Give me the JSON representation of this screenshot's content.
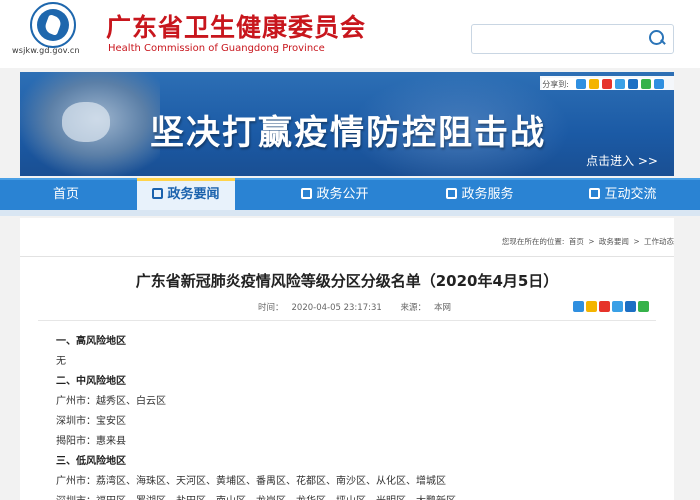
{
  "header": {
    "domain": "wsjkw.gd.gov.cn",
    "title": "广东省卫生健康委员会",
    "subtitle": "Health Commission of Guangdong Province",
    "search_placeholder": ""
  },
  "share": {
    "label": "分享到:"
  },
  "banner": {
    "slogan": "坚决打赢疫情防控阻击战",
    "enter": "点击进入 >>"
  },
  "nav": {
    "items": [
      {
        "label": "首页"
      },
      {
        "label": "政务要闻"
      },
      {
        "label": "政务公开"
      },
      {
        "label": "政务服务"
      },
      {
        "label": "互动交流"
      }
    ]
  },
  "breadcrumb": {
    "prefix": "您现在所在的位置:",
    "items": [
      "首页",
      "政务要闻",
      "工作动态"
    ],
    "sep": ">"
  },
  "article": {
    "title": "广东省新冠肺炎疫情风险等级分区分级名单（2020年4月5日）",
    "time_label": "时间：",
    "time": "2020-04-05 23:17:31",
    "source_label": "来源：",
    "source": "本网",
    "lines": [
      {
        "text": "一、高风险地区",
        "heading": true
      },
      {
        "text": "无",
        "heading": false
      },
      {
        "text": "二、中风险地区",
        "heading": true
      },
      {
        "text": "广州市：越秀区、白云区",
        "heading": false
      },
      {
        "text": "深圳市：宝安区",
        "heading": false
      },
      {
        "text": "揭阳市：惠来县",
        "heading": false
      },
      {
        "text": "三、低风险地区",
        "heading": true
      },
      {
        "text": "广州市：荔湾区、海珠区、天河区、黄埔区、番禺区、花都区、南沙区、从化区、增城区",
        "heading": false
      },
      {
        "text": "深圳市：福田区、罗湖区、盐田区、南山区、龙岗区、龙华区、坪山区、光明区、大鹏新区",
        "heading": false
      }
    ]
  },
  "colors": {
    "brand_red": "#c8161d",
    "nav_blue": "#2a83d3",
    "banner_blue": "#1b5aa5"
  },
  "share_icons": [
    "plus-icon",
    "qzone-icon",
    "weibo-icon",
    "tqq-icon",
    "renren-icon",
    "wechat-icon"
  ]
}
